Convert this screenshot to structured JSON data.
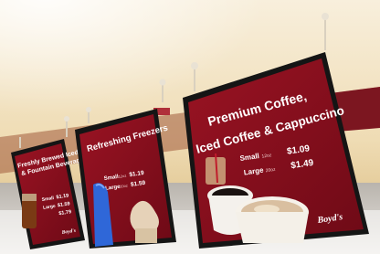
{
  "colors": {
    "panel": "#8a0f1e",
    "frame": "#151515",
    "ceiling_light": "#f7efe0",
    "ceiling_shadow": "#c9a96a",
    "bulkhead": "#8a1620"
  },
  "boards": [
    {
      "title_lines": [
        "Freshly Brewed Iced Tea",
        "& Fountain Beverages"
      ],
      "prices": [
        {
          "size": "Small",
          "unit": "",
          "price": "$1.19"
        },
        {
          "size": "Large",
          "unit": "",
          "price": "$1.59"
        },
        {
          "size": "",
          "unit": "",
          "price": "$1.79"
        }
      ],
      "brand": "Boyd's"
    },
    {
      "title_lines": [
        "Refreshing Freezers"
      ],
      "prices": [
        {
          "size": "Small",
          "unit": "12oz",
          "price": "$1.19"
        },
        {
          "size": "Large",
          "unit": "20oz",
          "price": "$1.59"
        }
      ]
    },
    {
      "title_lines": [
        "Premium Coffee,",
        "Iced Coffee & Cappuccino"
      ],
      "prices": [
        {
          "size": "Small",
          "unit": "12oz",
          "price": "$1.09"
        },
        {
          "size": "Large",
          "unit": "20oz",
          "price": "$1.49"
        }
      ],
      "brand": "Boyd's"
    }
  ]
}
